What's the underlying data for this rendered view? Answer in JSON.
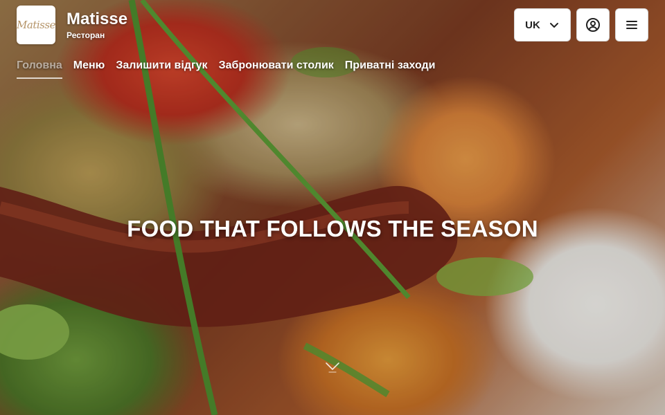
{
  "brand": {
    "name": "Matisse",
    "subtitle": "Ресторан",
    "logo_text": "Matisse"
  },
  "nav": {
    "items": [
      {
        "label": "Головна",
        "active": true
      },
      {
        "label": "Меню",
        "active": false
      },
      {
        "label": "Залишити відгук",
        "active": false
      },
      {
        "label": "Забронювати столик",
        "active": false
      },
      {
        "label": "Приватні заходи",
        "active": false
      }
    ]
  },
  "top_actions": {
    "language": "UK",
    "language_icon": "chevron-down-icon",
    "account_icon": "user-circle-icon",
    "menu_icon": "hamburger-menu-icon"
  },
  "hero": {
    "headline": "FOOD THAT FOLLOWS THE SEASON",
    "scroll_icon": "chevron-down-icon"
  },
  "colors": {
    "text_on_image": "#ffffff",
    "button_bg": "#ffffff",
    "button_border": "#d6d6d6",
    "logo_script": "#b59468"
  }
}
